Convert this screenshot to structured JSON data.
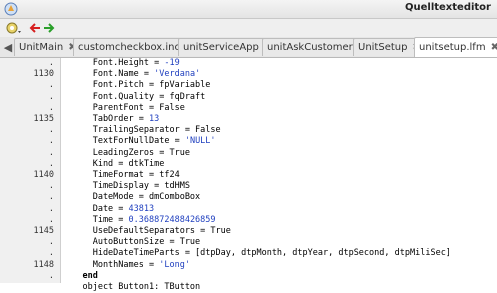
{
  "window": {
    "title": "Quelltexteditor"
  },
  "toolbar": {
    "buttons": [
      "settings-icon",
      "back-arrow-icon",
      "forward-arrow-icon"
    ]
  },
  "tabs": [
    {
      "label": "UnitMain",
      "active": false
    },
    {
      "label": "customcheckbox.inc",
      "active": false
    },
    {
      "label": "unitServiceApp",
      "active": false
    },
    {
      "label": "unitAskCustomer",
      "active": false
    },
    {
      "label": "UnitSetup",
      "active": false
    },
    {
      "label": "unitsetup.lfm",
      "active": true
    }
  ],
  "gutter": [
    ".",
    "1130",
    ".",
    ".",
    ".",
    "1135",
    ".",
    ".",
    ".",
    ".",
    "1140",
    ".",
    ".",
    ".",
    ".",
    "1145",
    ".",
    ".",
    "1148",
    "."
  ],
  "code": [
    [
      {
        "t": "      Font.Height = "
      },
      {
        "t": "-19",
        "c": "num"
      }
    ],
    [
      {
        "t": "      Font.Name = "
      },
      {
        "t": "'Verdana'",
        "c": "str"
      }
    ],
    [
      {
        "t": "      Font.Pitch = fpVariable"
      }
    ],
    [
      {
        "t": "      Font.Quality = fqDraft"
      }
    ],
    [
      {
        "t": "      ParentFont = False"
      }
    ],
    [
      {
        "t": "      TabOrder = "
      },
      {
        "t": "13",
        "c": "num"
      }
    ],
    [
      {
        "t": "      TrailingSeparator = False"
      }
    ],
    [
      {
        "t": "      TextForNullDate = "
      },
      {
        "t": "'NULL'",
        "c": "str"
      }
    ],
    [
      {
        "t": "      LeadingZeros = True"
      }
    ],
    [
      {
        "t": "      Kind = dtkTime"
      }
    ],
    [
      {
        "t": "      TimeFormat = tf24"
      }
    ],
    [
      {
        "t": "      TimeDisplay = tdHMS"
      }
    ],
    [
      {
        "t": "      DateMode = dmComboBox"
      }
    ],
    [
      {
        "t": "      Date = "
      },
      {
        "t": "43813",
        "c": "num"
      }
    ],
    [
      {
        "t": "      Time = "
      },
      {
        "t": "0.368872488426859",
        "c": "num"
      }
    ],
    [
      {
        "t": "      UseDefaultSeparators = True"
      }
    ],
    [
      {
        "t": "      AutoButtonSize = True"
      }
    ],
    [
      {
        "t": "      HideDateTimeParts = [dtpDay, dtpMonth, dtpYear, dtpSecond, dtpMiliSec]"
      }
    ],
    [
      {
        "t": "      MonthNames = "
      },
      {
        "t": "'Long'",
        "c": "str"
      }
    ],
    [
      {
        "t": "    "
      },
      {
        "t": "end",
        "c": "kw"
      }
    ],
    [
      {
        "t": "    object Button1: TButton"
      }
    ]
  ]
}
